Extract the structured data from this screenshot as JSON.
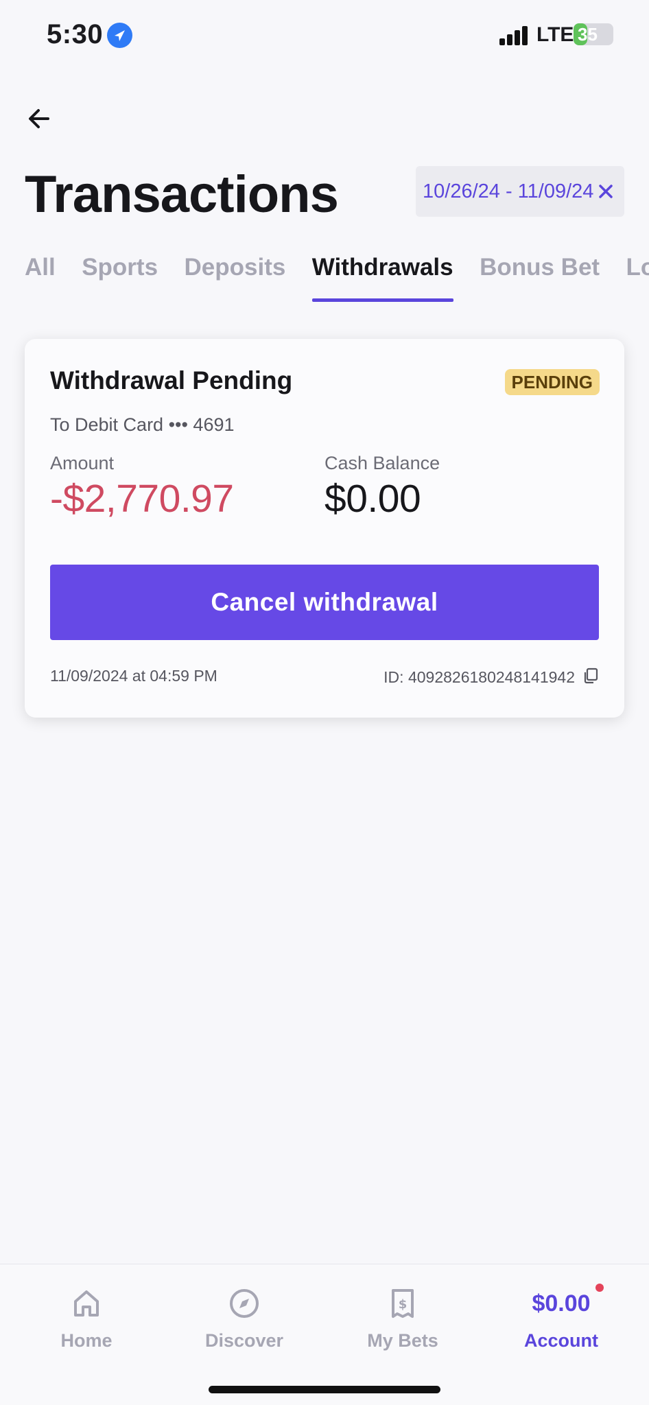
{
  "status_bar": {
    "time": "5:30",
    "network": "LTE",
    "battery": "35",
    "battery_level": 0.35,
    "icons": [
      "location-arrow-icon",
      "signal-icon",
      "battery-icon"
    ]
  },
  "header": {
    "title": "Transactions",
    "back_icon": "arrow-left-icon",
    "date_range": "10/26/24 - 11/09/24",
    "clear_icon": "close-icon"
  },
  "tabs": [
    {
      "label": "All",
      "active": false
    },
    {
      "label": "Sports",
      "active": false
    },
    {
      "label": "Deposits",
      "active": false
    },
    {
      "label": "Withdrawals",
      "active": true
    },
    {
      "label": "Bonus Bet",
      "active": false
    },
    {
      "label": "Loyalty",
      "active": false
    }
  ],
  "transaction": {
    "title": "Withdrawal Pending",
    "status": "PENDING",
    "destination": "To Debit Card ••• 4691",
    "amount_label": "Amount",
    "amount": "-$2,770.97",
    "balance_label": "Cash Balance",
    "balance": "$0.00",
    "action_label": "Cancel withdrawal",
    "timestamp": "11/09/2024 at 04:59 PM",
    "id": "ID: 409282618024814194 2",
    "copy_icon": "copy-icon"
  },
  "bottom_nav": {
    "items": [
      {
        "label": "Home",
        "icon": "home-icon"
      },
      {
        "label": "Discover",
        "icon": "compass-icon"
      },
      {
        "label": "My Bets",
        "icon": "bet-slip-icon"
      },
      {
        "label": "Account",
        "balance": "$0.00",
        "active": true
      }
    ]
  },
  "colors": {
    "accent": "#6649e6",
    "negative": "#cf4a61",
    "badge_bg": "#f5d98a",
    "background": "#f7f7fa"
  }
}
